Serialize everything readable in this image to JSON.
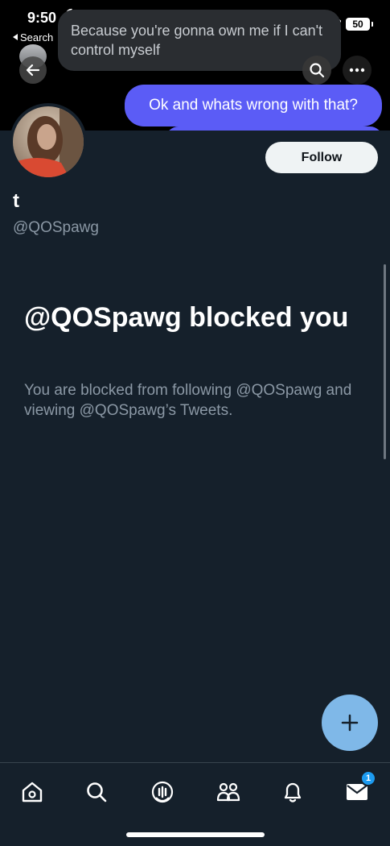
{
  "status_bar": {
    "time": "9:50",
    "back_app_label": "Search",
    "battery": "50"
  },
  "notification": {
    "message": "Because you're gonna own me if I can't control myself"
  },
  "chat": {
    "bubble_text": "Ok and whats wrong with that?"
  },
  "profile": {
    "name": "t",
    "handle": "@QOSpawg",
    "follow_label": "Follow"
  },
  "blocked": {
    "title": "@QOSpawg blocked you",
    "description": "You are blocked from following @QOSpawg and viewing @QOSpawg’s Tweets."
  },
  "tabbar": {
    "items": [
      "home-icon",
      "search-icon",
      "spaces-icon",
      "communities-icon",
      "notifications-icon",
      "messages-icon"
    ],
    "messages_badge": "1"
  },
  "colors": {
    "background": "#15202b",
    "bubble": "#5b5cf6",
    "fab": "#7fb8e8",
    "secondary_text": "#8b98a5"
  }
}
